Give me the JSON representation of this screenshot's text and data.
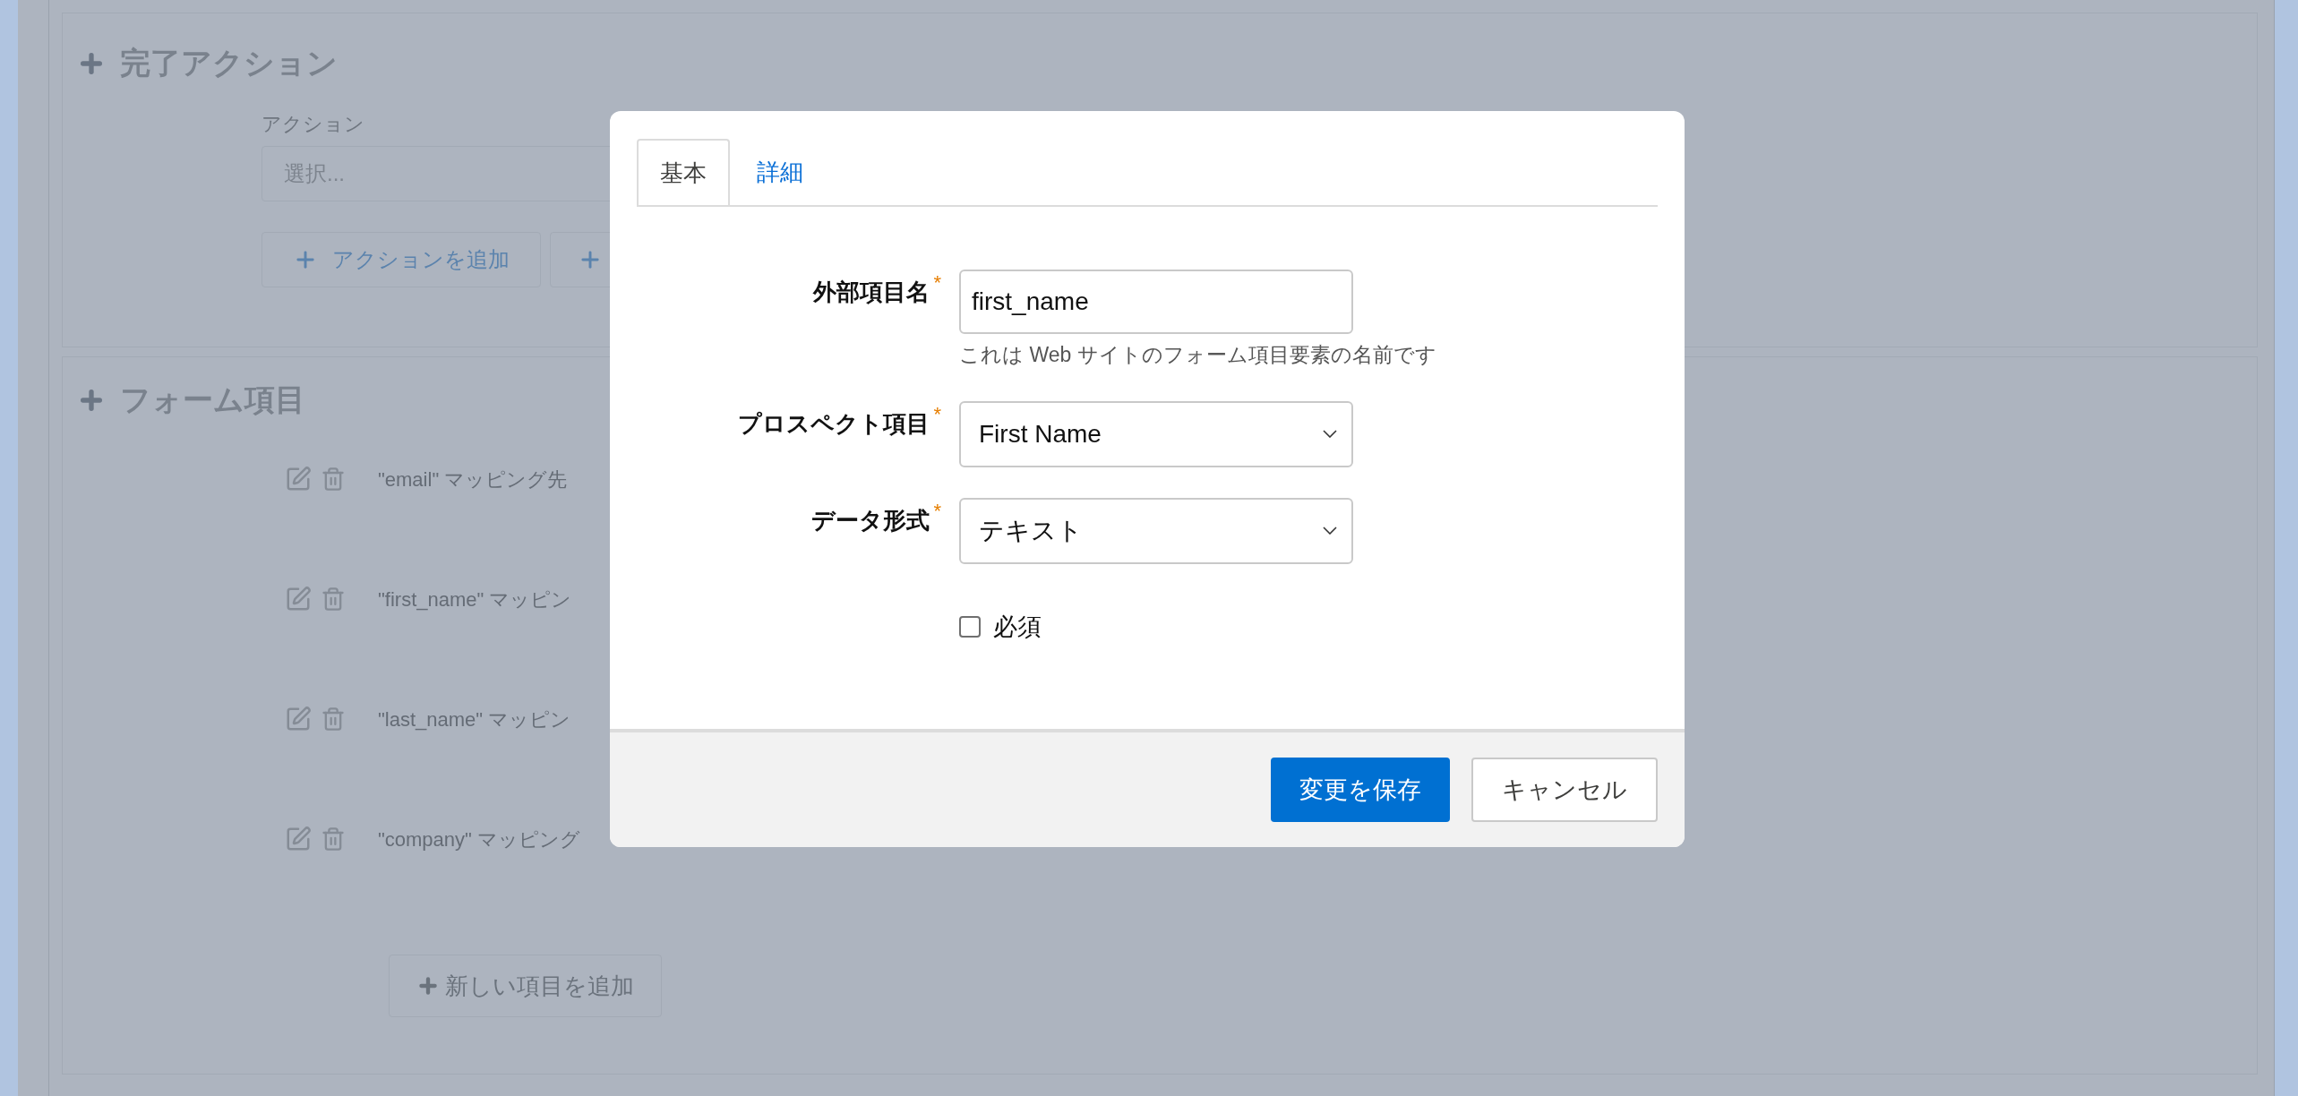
{
  "completion_actions": {
    "title": "完了アクション",
    "action_label": "アクション",
    "action_placeholder": "選択...",
    "add_action_button": "アクションを追加"
  },
  "form_fields": {
    "title": "フォーム項目",
    "rows": [
      {
        "text": "\"email\" マッピング先"
      },
      {
        "text": "\"first_name\" マッピン"
      },
      {
        "text": "\"last_name\" マッピン"
      },
      {
        "text": "\"company\" マッピング"
      }
    ],
    "add_button": "新しい項目を追加"
  },
  "modal": {
    "tabs": [
      {
        "label": "基本",
        "selected": true
      },
      {
        "label": "詳細",
        "selected": false
      }
    ],
    "fields": [
      {
        "kind": "text",
        "label": "外部項目名",
        "required": true,
        "value": "first_name",
        "help": "これは Web サイトのフォーム項目要素の名前です"
      },
      {
        "kind": "select",
        "label": "プロスペクト項目",
        "required": true,
        "value": "First Name"
      },
      {
        "kind": "select",
        "label": "データ形式",
        "required": true,
        "value": "テキスト"
      },
      {
        "kind": "checkbox",
        "label": "必須",
        "checked": false
      }
    ],
    "required_mark": "*",
    "buttons": [
      {
        "label": "変更を保存",
        "kind": "primary"
      },
      {
        "label": "キャンセル",
        "kind": "secondary"
      }
    ]
  }
}
